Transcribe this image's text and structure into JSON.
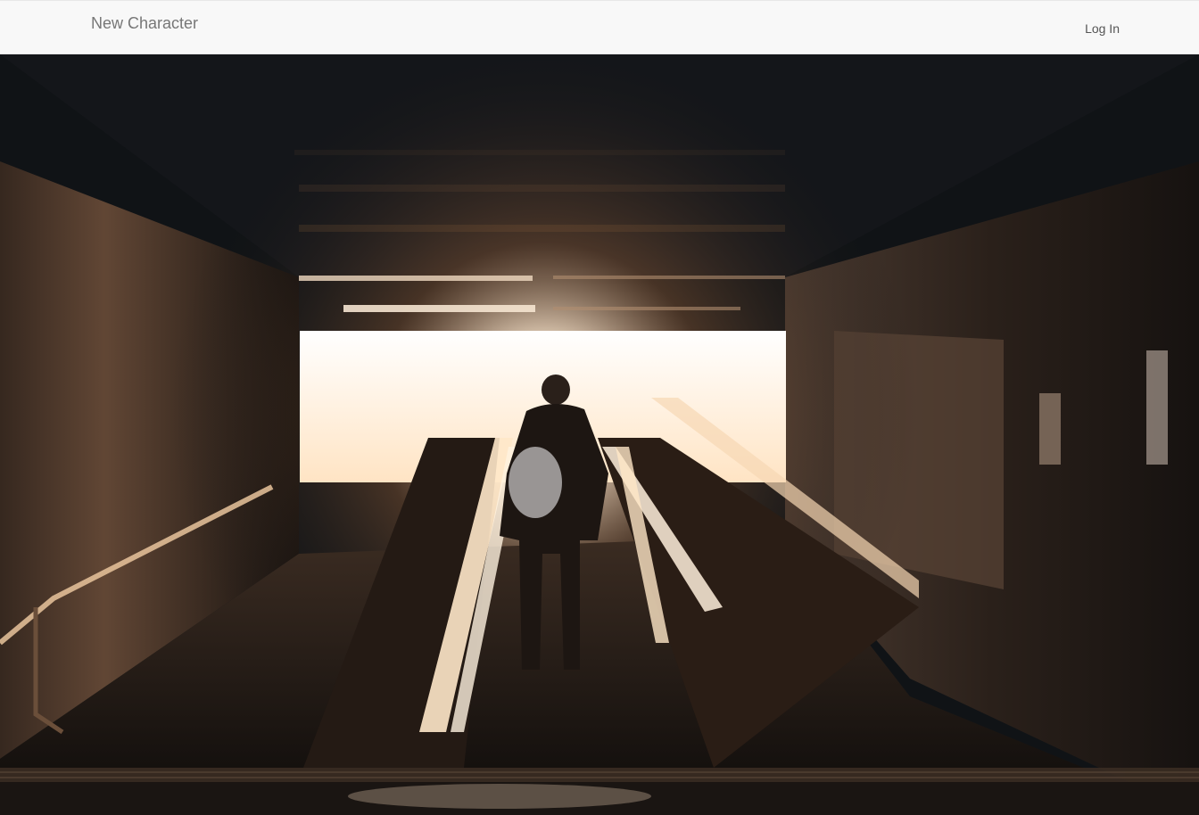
{
  "navbar": {
    "brand": "New Character",
    "login_label": "Log In"
  },
  "hero": {
    "image_subject": "tunnel-with-moving-walkways-backlit-figure",
    "colors": {
      "shadow": "#101316",
      "wall": "#2a1f19",
      "light": "#fff6ea",
      "glow": "#e8b98a",
      "rail": "#ffd9b0"
    }
  }
}
